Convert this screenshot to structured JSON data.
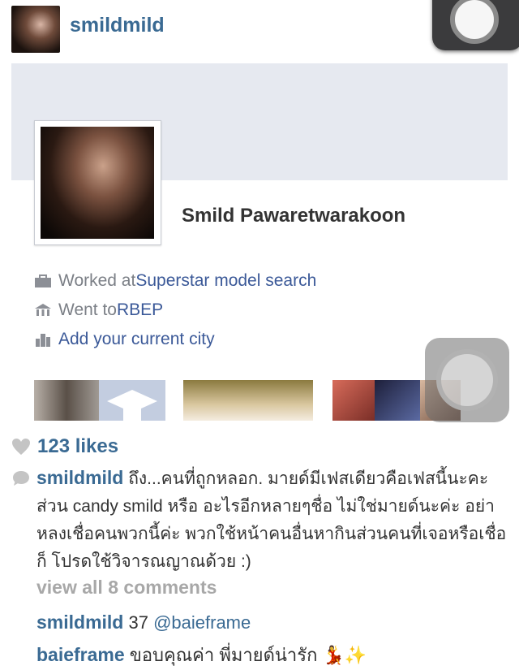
{
  "header": {
    "username": "smildmild"
  },
  "facebook_profile": {
    "name": "Smild Pawaretwarakoon",
    "info": [
      {
        "icon": "briefcase-icon",
        "prefix": "Worked at ",
        "link": "Superstar model search"
      },
      {
        "icon": "school-icon",
        "prefix": "Went to ",
        "link": "RBEP"
      },
      {
        "icon": "city-icon",
        "prefix": "",
        "link": "Add your current city"
      }
    ]
  },
  "post": {
    "likes": "123 likes",
    "caption_user": "smildmild",
    "caption_text": "ถึง...คนที่ถูกหลอก. มายด์มีเฟสเดียวคือเฟสนี้นะคะ ส่วน candy smild หรือ อะไรอีกหลายๆชื่อ ไม่ใช่มายด์นะค่ะ อย่าหลงเชื่อคนพวกนี้ค่ะ พวกใช้หน้าคนอื่นหากินส่วนคนที่เจอหรือเชื่อก็ โปรดใช้วิจารณญาณด้วย :)",
    "view_all": "view all 8 comments",
    "comments": [
      {
        "user": "smildmild",
        "text_plain": "37 ",
        "mention": "@baieframe"
      },
      {
        "user": "baieframe",
        "text_plain": "ขอบคุณค่า พี่มายด์น่ารัก 💃✨",
        "mention": ""
      }
    ]
  },
  "colors": {
    "username_blue": "#3a6a93",
    "fb_link_blue": "#3b5998",
    "gray_text": "#a8a8a8"
  }
}
